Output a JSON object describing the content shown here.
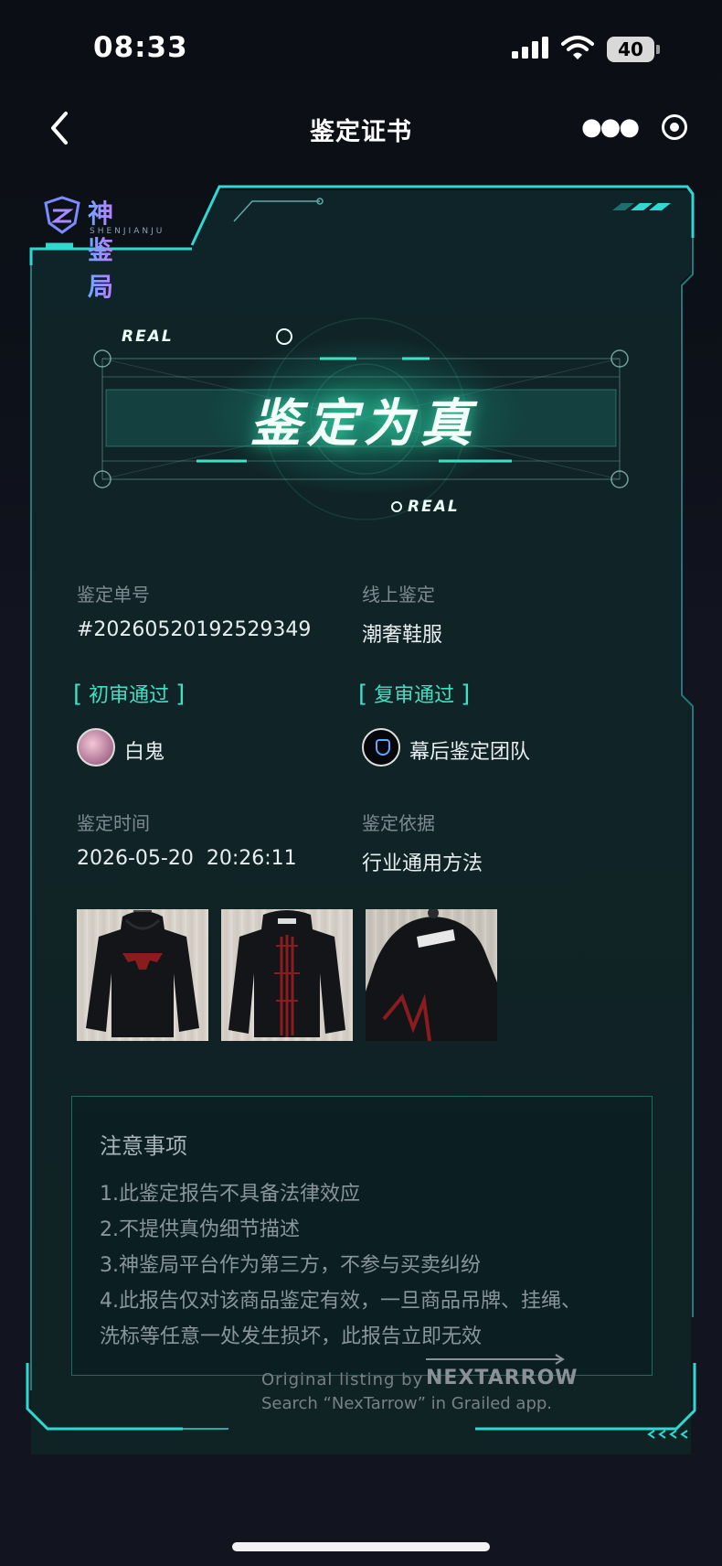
{
  "status_bar": {
    "time": "08:33",
    "battery": "40"
  },
  "nav": {
    "title": "鉴定证书"
  },
  "brand": {
    "name": "神鉴局",
    "sub": "SHENJIANJU"
  },
  "hero": {
    "title": "鉴定为真",
    "tag_top": "REAL",
    "tag_bottom": "REAL"
  },
  "info": {
    "order_label": "鉴定单号",
    "order_value": "#20260520192529349",
    "type_label": "线上鉴定",
    "type_value": "潮奢鞋服",
    "first_review_badge": "初审通过",
    "first_reviewer": "白鬼",
    "second_review_badge": "复审通过",
    "second_reviewer": "幕后鉴定团队",
    "time_label": "鉴定时间",
    "time_value": "2026-05-20  20:26:11",
    "basis_label": "鉴定依据",
    "basis_value": "行业通用方法"
  },
  "notice": {
    "title": "注意事项",
    "items": [
      "1.此鉴定报告不具备法律效应",
      "2.不提供真伪细节描述",
      "3.神鉴局平台作为第三方，不参与买卖纠纷",
      "4.此报告仅对该商品鉴定有效，一旦商品吊牌、挂绳、",
      "洗标等任意一处发生损坏，此报告立即无效"
    ]
  },
  "watermark": {
    "line1": "Original listing by",
    "brand": "NEXTARROW",
    "line2": "Search “NexTarrow” in Grailed app."
  },
  "colors": {
    "accent": "#3fe0c4",
    "frame": "#2fd8d0",
    "background": "#121420"
  }
}
